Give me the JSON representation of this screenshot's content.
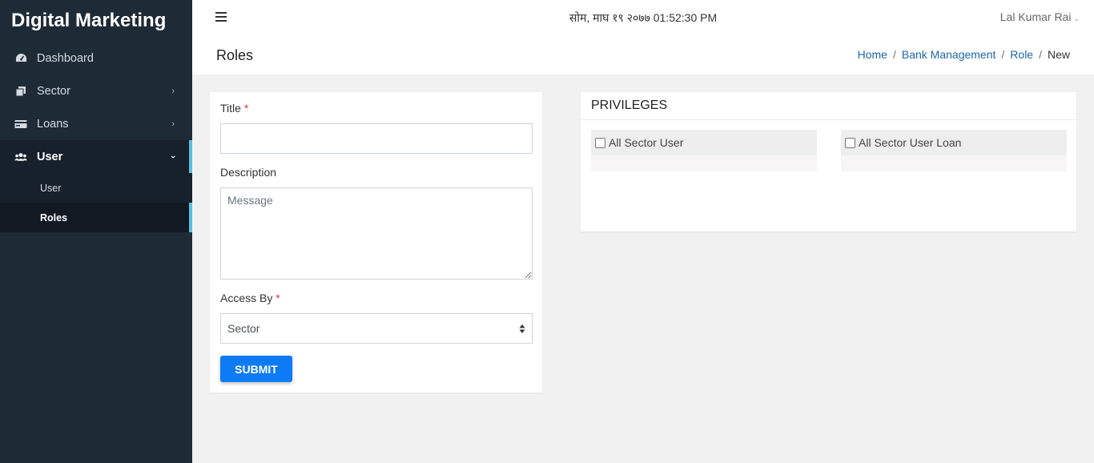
{
  "sidebar": {
    "brand": "Digital Marketing",
    "items": [
      {
        "label": "Dashboard",
        "icon": "dashboard-icon"
      },
      {
        "label": "Sector",
        "icon": "copy-icon",
        "has_children": true
      },
      {
        "label": "Loans",
        "icon": "cash-icon",
        "has_children": true
      },
      {
        "label": "User",
        "icon": "users-icon",
        "has_children": true,
        "expanded": true
      }
    ],
    "subitems": [
      {
        "label": "User"
      },
      {
        "label": "Roles",
        "active": true
      }
    ]
  },
  "topbar": {
    "datetime": "सोम, माघ १९ २०७७ 01:52:30 PM",
    "user_name": "Lal Kumar Rai"
  },
  "page": {
    "title": "Roles",
    "breadcrumb": [
      "Home",
      "Bank Management",
      "Role",
      "New"
    ]
  },
  "form": {
    "title_label": "Title",
    "title_value": "",
    "required_mark": "*",
    "description_label": "Description",
    "description_placeholder": "Message",
    "access_label": "Access By",
    "access_selected": "Sector",
    "submit_label": "SUBMIT"
  },
  "privileges": {
    "title": "PRIVILEGES",
    "items": [
      {
        "label": "All Sector User",
        "checked": false
      },
      {
        "label": "All Sector User Loan",
        "checked": false
      }
    ]
  },
  "colors": {
    "sidebar_bg": "#1e2a36",
    "accent": "#5bc0de",
    "primary": "#0d7bf5",
    "link": "#1a66a8",
    "required": "#dc3545"
  }
}
